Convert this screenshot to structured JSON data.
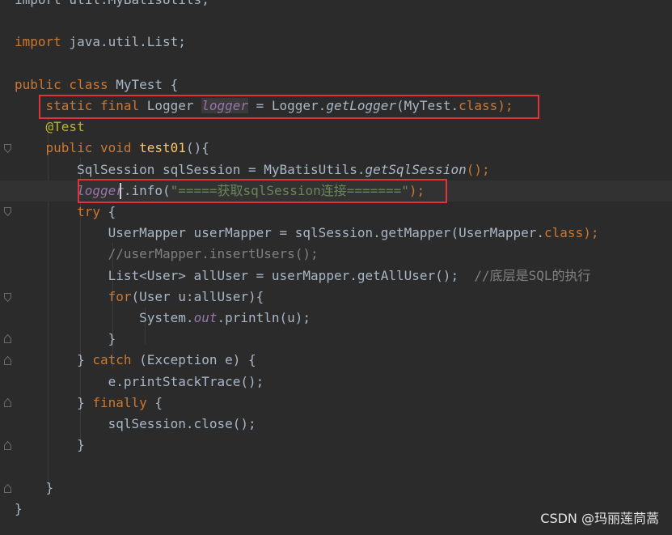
{
  "code_lines": [
    [
      {
        "t": "import util.MyBatisUtils;",
        "c": "plain"
      }
    ],
    [],
    [
      {
        "t": "import",
        "c": "kw"
      },
      {
        "t": " java.util.List;",
        "c": "plain"
      }
    ],
    [],
    [
      {
        "t": "public class",
        "c": "kw"
      },
      {
        "t": " MyTest {",
        "c": "plain"
      }
    ],
    [
      {
        "t": "    "
      },
      {
        "t": "static final",
        "c": "kw"
      },
      {
        "t": " Logger ",
        "c": "plain"
      },
      {
        "t": "logger",
        "c": "field-hl"
      },
      {
        "t": " = Logger.",
        "c": "plain"
      },
      {
        "t": "getLogger",
        "c": "italic-m"
      },
      {
        "t": "(MyTest.",
        "c": "plain"
      },
      {
        "t": "class",
        "c": "kw"
      },
      {
        "t": ");",
        "c": "kw"
      }
    ],
    [
      {
        "t": "    "
      },
      {
        "t": "@Test",
        "c": "anno"
      }
    ],
    [
      {
        "t": "    "
      },
      {
        "t": "public void",
        "c": "kw"
      },
      {
        "t": " ",
        "c": "plain"
      },
      {
        "t": "test01",
        "c": "method"
      },
      {
        "t": "(){",
        "c": "plain"
      }
    ],
    [
      {
        "t": "        SqlSession sqlSession = MyBatisUtils.",
        "c": "plain"
      },
      {
        "t": "getSqlSession",
        "c": "italic-m"
      },
      {
        "t": "();",
        "c": "kw"
      }
    ],
    [
      {
        "t": "        "
      },
      {
        "t": "logger",
        "c": "field"
      },
      {
        "t": ".info(",
        "c": "plain"
      },
      {
        "t": "\"=====获取sqlSession连接=======\"",
        "c": "string"
      },
      {
        "t": ");",
        "c": "kw"
      }
    ],
    [
      {
        "t": "        "
      },
      {
        "t": "try",
        "c": "kw"
      },
      {
        "t": " {",
        "c": "plain"
      }
    ],
    [
      {
        "t": "            UserMapper userMapper = sqlSession.getMapper(UserMapper.",
        "c": "plain"
      },
      {
        "t": "class",
        "c": "kw"
      },
      {
        "t": ");",
        "c": "kw"
      }
    ],
    [
      {
        "t": "            "
      },
      {
        "t": "//userMapper.insertUsers();",
        "c": "comment"
      }
    ],
    [
      {
        "t": "            List<User> allUser = userMapper.getAllUser();",
        "c": "plain"
      },
      {
        "t": "  //底层是SQL的执行",
        "c": "comment"
      }
    ],
    [
      {
        "t": "            "
      },
      {
        "t": "for",
        "c": "kw"
      },
      {
        "t": "(User u:allUser){",
        "c": "plain"
      }
    ],
    [
      {
        "t": "                System.",
        "c": "plain"
      },
      {
        "t": "out",
        "c": "field"
      },
      {
        "t": ".println(u);",
        "c": "plain"
      }
    ],
    [
      {
        "t": "            }",
        "c": "plain"
      }
    ],
    [
      {
        "t": "        } ",
        "c": "plain"
      },
      {
        "t": "catch",
        "c": "kw"
      },
      {
        "t": " (Exception e) {",
        "c": "plain"
      }
    ],
    [
      {
        "t": "            e.printStackTrace();",
        "c": "plain"
      }
    ],
    [
      {
        "t": "        } ",
        "c": "plain"
      },
      {
        "t": "finally",
        "c": "kw"
      },
      {
        "t": " {",
        "c": "plain"
      }
    ],
    [
      {
        "t": "            sqlSession.close();",
        "c": "plain"
      }
    ],
    [
      {
        "t": "        }",
        "c": "plain"
      }
    ],
    [],
    [
      {
        "t": "    }",
        "c": "plain"
      }
    ],
    [
      {
        "t": "}",
        "c": "plain"
      }
    ]
  ],
  "watermark": "CSDN @玛丽莲茼蒿",
  "colors": {
    "background": "#2b2b2b",
    "keyword": "#cc7832",
    "text": "#a9b7c6",
    "field": "#9876aa",
    "method": "#ffc66d",
    "string": "#6a8759",
    "comment": "#808080",
    "annotation": "#bbb529",
    "highlight_box": "#e0343a"
  }
}
